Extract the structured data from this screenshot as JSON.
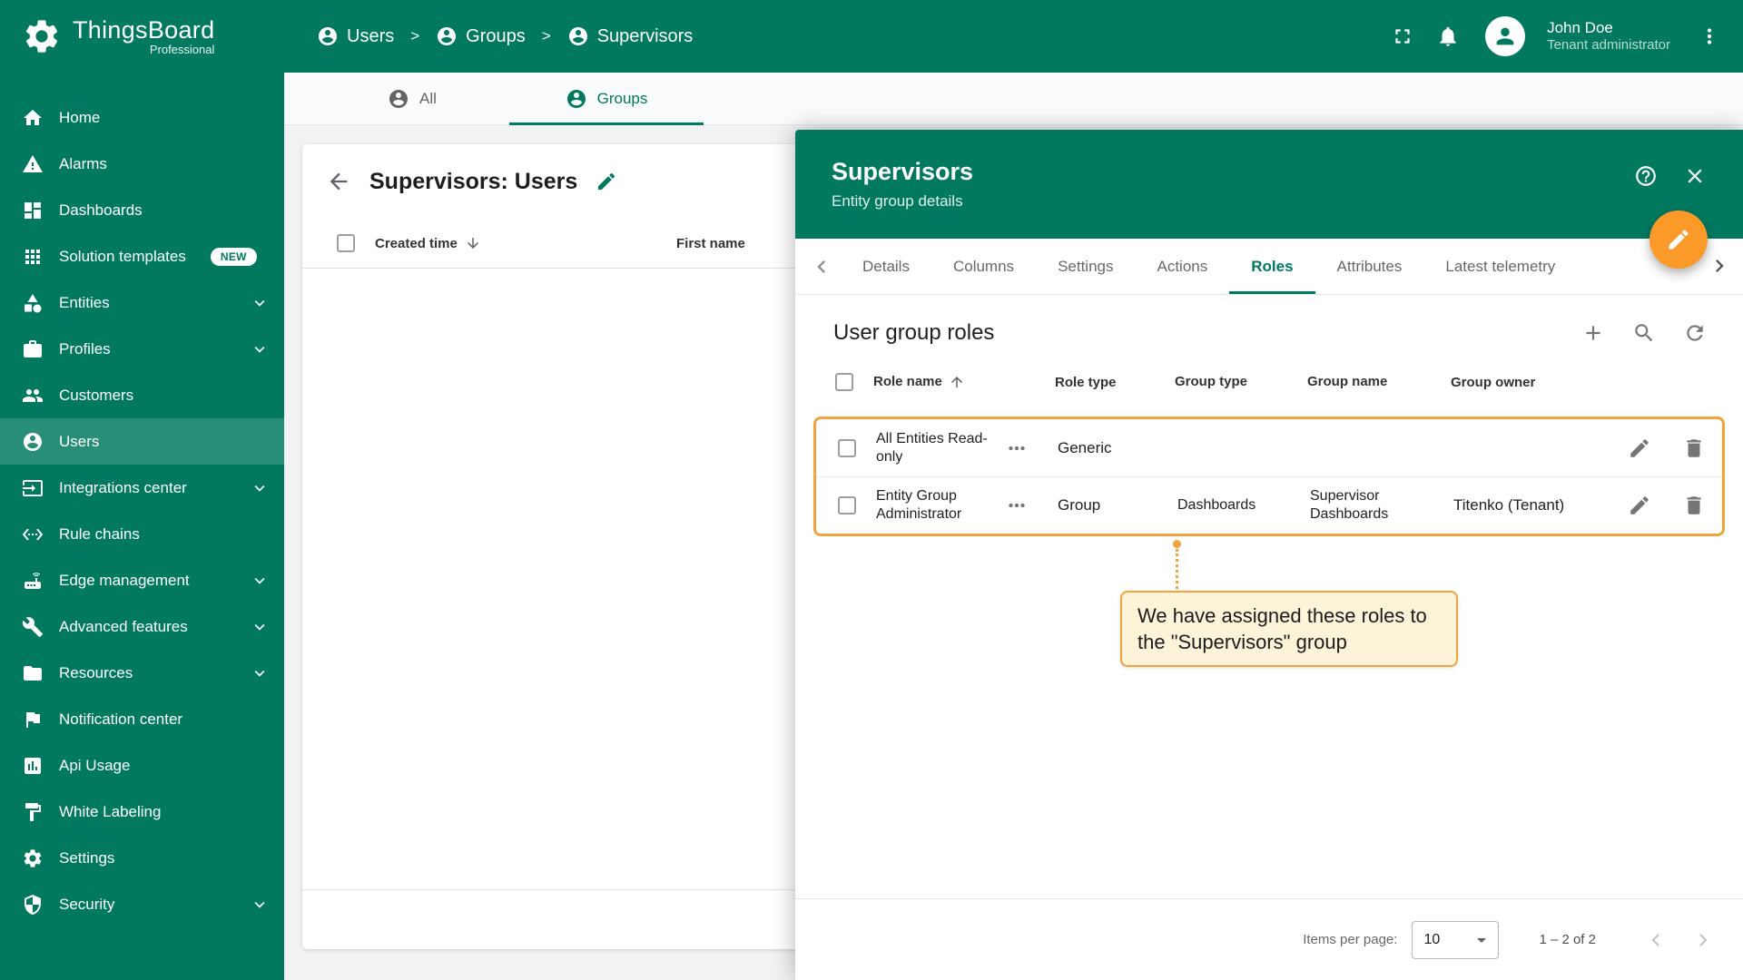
{
  "colors": {
    "brand_green": "#00795f",
    "accent_orange": "#f2a33c",
    "fab_orange": "#fb9a28",
    "callout_bg": "#fcf3d8"
  },
  "app": {
    "name": "ThingsBoard",
    "edition": "Professional"
  },
  "header": {
    "separator": ">",
    "breadcrumb": [
      {
        "label": "Users"
      },
      {
        "label": "Groups"
      },
      {
        "label": "Supervisors"
      }
    ],
    "user": {
      "name": "John Doe",
      "role": "Tenant administrator"
    }
  },
  "sidebar": {
    "items": [
      {
        "label": "Home",
        "icon": "home"
      },
      {
        "label": "Alarms",
        "icon": "warning"
      },
      {
        "label": "Dashboards",
        "icon": "dashboard"
      },
      {
        "label": "Solution templates",
        "icon": "apps",
        "badge": "NEW"
      },
      {
        "label": "Entities",
        "icon": "category",
        "expandable": true
      },
      {
        "label": "Profiles",
        "icon": "briefcase",
        "expandable": true
      },
      {
        "label": "Customers",
        "icon": "people"
      },
      {
        "label": "Users",
        "icon": "account",
        "active": true
      },
      {
        "label": "Integrations center",
        "icon": "input",
        "expandable": true
      },
      {
        "label": "Rule chains",
        "icon": "ethernet"
      },
      {
        "label": "Edge management",
        "icon": "router",
        "expandable": true
      },
      {
        "label": "Advanced features",
        "icon": "build",
        "expandable": true
      },
      {
        "label": "Resources",
        "icon": "folder",
        "expandable": true
      },
      {
        "label": "Notification center",
        "icon": "flag"
      },
      {
        "label": "Api Usage",
        "icon": "chart"
      },
      {
        "label": "White Labeling",
        "icon": "paint"
      },
      {
        "label": "Settings",
        "icon": "gear"
      },
      {
        "label": "Security",
        "icon": "shield",
        "expandable": true
      }
    ]
  },
  "main": {
    "tabs": [
      {
        "label": "All"
      },
      {
        "label": "Groups"
      }
    ],
    "card": {
      "title": "Supervisors: Users",
      "columns": [
        "Created time",
        "First name"
      ]
    }
  },
  "drawer": {
    "title": "Supervisors",
    "subtitle": "Entity group details",
    "tabs": [
      "Details",
      "Columns",
      "Settings",
      "Actions",
      "Roles",
      "Attributes",
      "Latest telemetry"
    ],
    "section_title": "User group roles",
    "table": {
      "columns": [
        "Role name",
        "Role type",
        "Group type",
        "Group name",
        "Group owner"
      ],
      "rows": [
        {
          "role_name": "All Entities Read-only",
          "role_type": "Generic",
          "group_type": "",
          "group_name": "",
          "group_owner": ""
        },
        {
          "role_name": "Entity Group Administrator",
          "role_type": "Group",
          "group_type": "Dashboards",
          "group_name": "Supervisor Dashboards",
          "group_owner": "Titenko (Tenant)"
        }
      ]
    },
    "callout": "We have assigned these roles to the \"Supervisors\" group",
    "paginator": {
      "label": "Items per page:",
      "value": "10",
      "range": "1 – 2 of 2"
    }
  }
}
